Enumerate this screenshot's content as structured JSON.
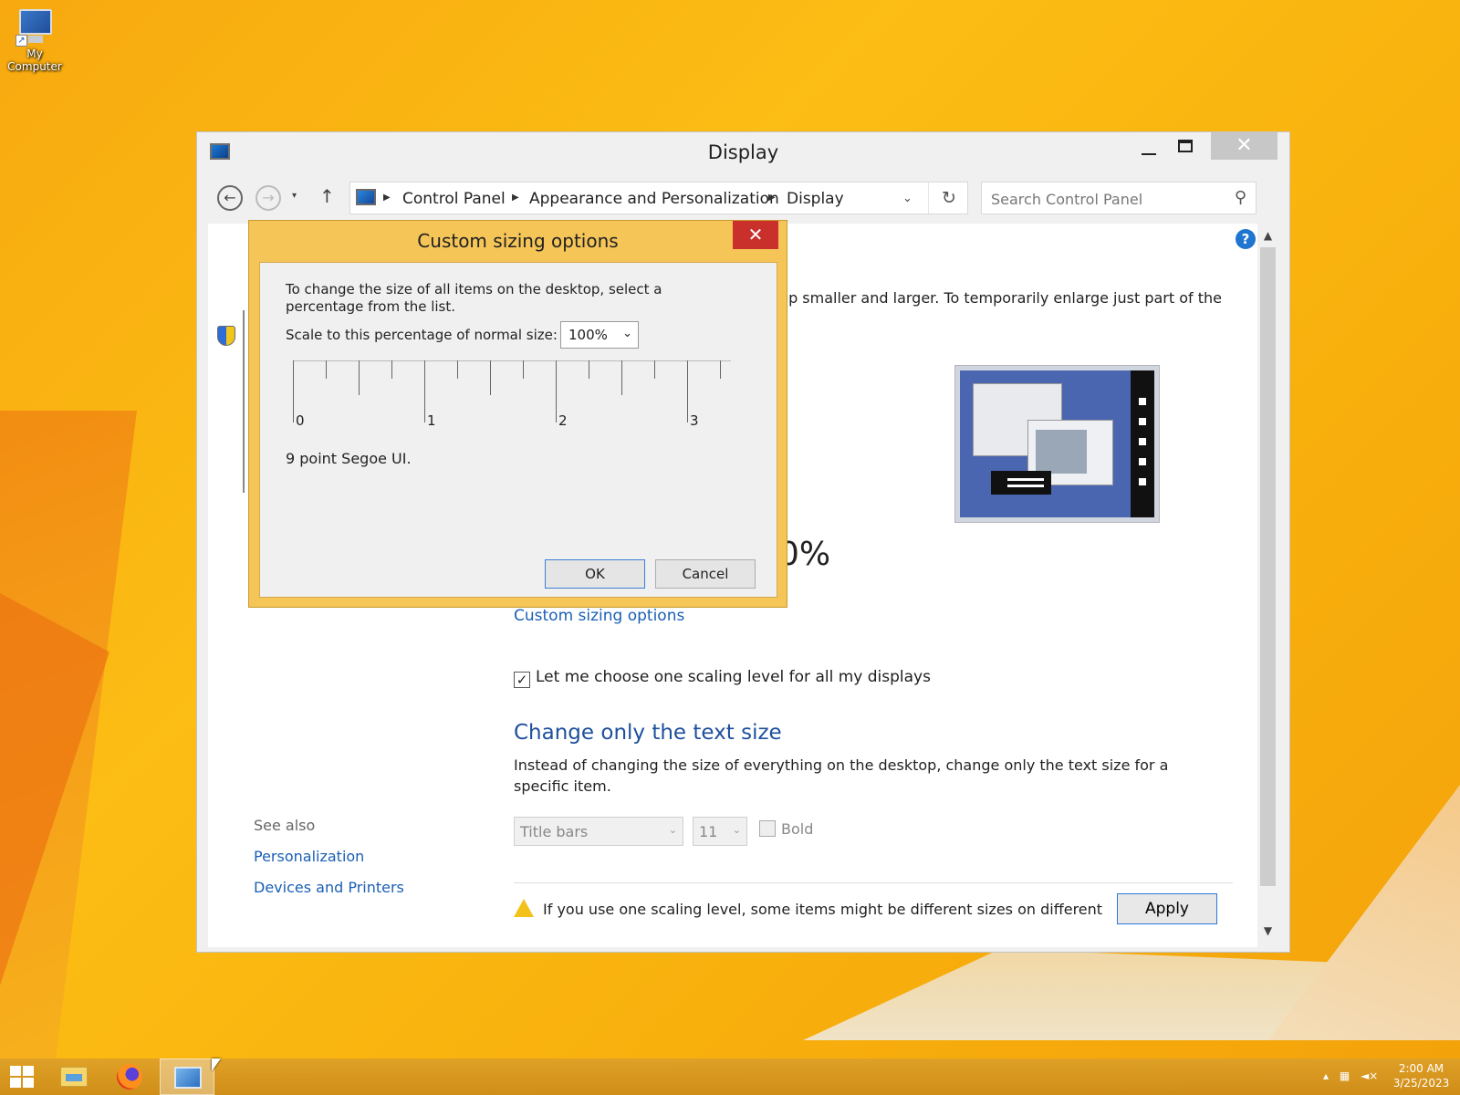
{
  "desktop": {
    "icons": [
      {
        "label": "My Computer",
        "icon": "computer-icon"
      }
    ]
  },
  "window": {
    "title": "Display",
    "controls": {
      "minimize": "minimize",
      "maximize": "maximize",
      "close": "✕"
    }
  },
  "nav": {
    "back": "back-arrow-icon",
    "forward": "forward-arrow-icon",
    "recent": "▾",
    "up": "↑",
    "breadcrumb": [
      "Control Panel",
      "Appearance and Personalization",
      "Display"
    ],
    "refresh": "↻",
    "search_placeholder": "Search Control Panel"
  },
  "content": {
    "intro_partial": "top smaller and larger. To temporarily enlarge just part of the",
    "big_percent_partial": "0%",
    "custom_sizing_link": "Custom sizing options",
    "scaling_checkbox": {
      "label": "Let me choose one scaling level for all my displays",
      "checked": true
    },
    "text_size_heading": "Change only the text size",
    "text_size_desc": "Instead of changing the size of everything on the desktop, change only the text size for a specific item.",
    "item_select": "Title bars",
    "size_select": "11",
    "bold_label": "Bold",
    "bold_checked": false,
    "warning_text": "If you use one scaling level, some items might be different sizes on different",
    "apply": "Apply"
  },
  "see_also": {
    "title": "See also",
    "links": [
      "Personalization",
      "Devices and Printers"
    ]
  },
  "dialog": {
    "title": "Custom sizing options",
    "close": "✕",
    "description": "To change the size of all items on the desktop, select a percentage from the list.",
    "scale_label": "Scale to this percentage of normal size:",
    "scale_value": "100%",
    "ruler_labels": [
      "0",
      "1",
      "2",
      "3"
    ],
    "font_note": "9 point Segoe UI.",
    "ok": "OK",
    "cancel": "Cancel"
  },
  "taskbar": {
    "items": [
      "start-button",
      "file-explorer",
      "firefox",
      "control-panel"
    ],
    "clock": {
      "time": "2:00 AM",
      "date": "3/25/2023"
    }
  }
}
